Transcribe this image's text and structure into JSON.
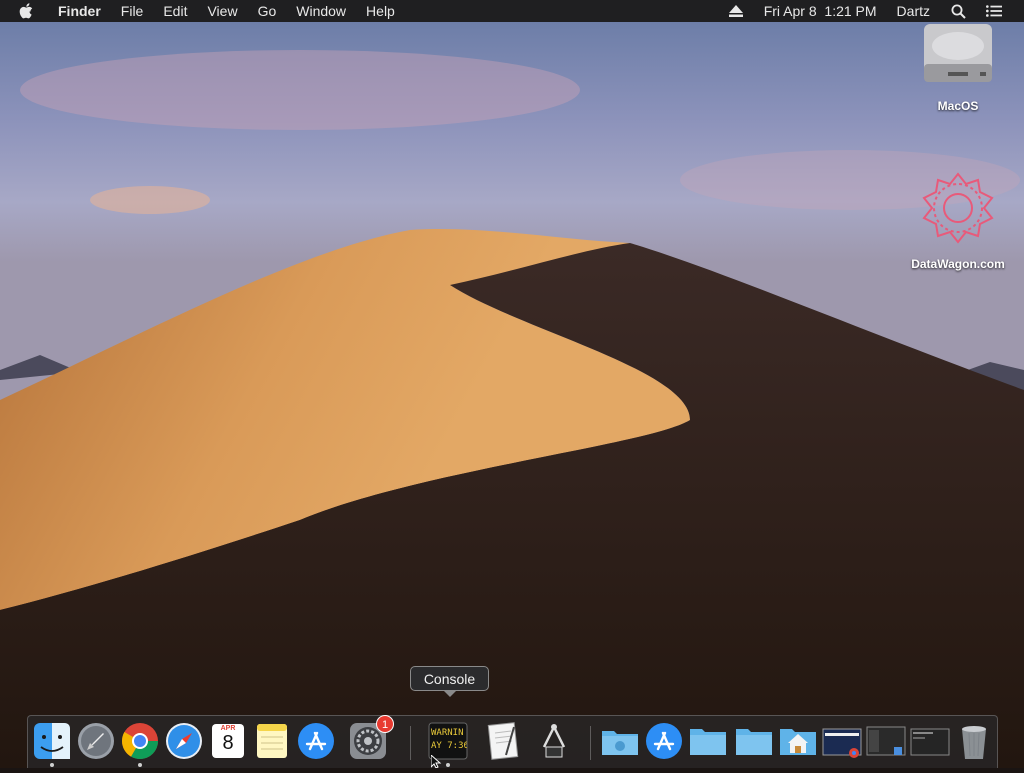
{
  "menubar": {
    "app_name": "Finder",
    "items": [
      "File",
      "Edit",
      "View",
      "Go",
      "Window",
      "Help"
    ],
    "clock": "Fri Apr 8  1:21 PM",
    "user": "Dartz"
  },
  "desktop": {
    "icons": [
      {
        "label": "MacOS"
      },
      {
        "label": "DataWagon.com"
      }
    ]
  },
  "tooltip": {
    "text": "Console"
  },
  "dock": {
    "calendar": {
      "month": "APR",
      "day": "8"
    },
    "system_preferences_badge": "1",
    "console_lines": [
      "WARNIN",
      "AY 7:36"
    ]
  },
  "colors": {
    "menubar_bg": "#1f1f21",
    "badge": "#e83a30",
    "folder": "#5fb3e8"
  }
}
